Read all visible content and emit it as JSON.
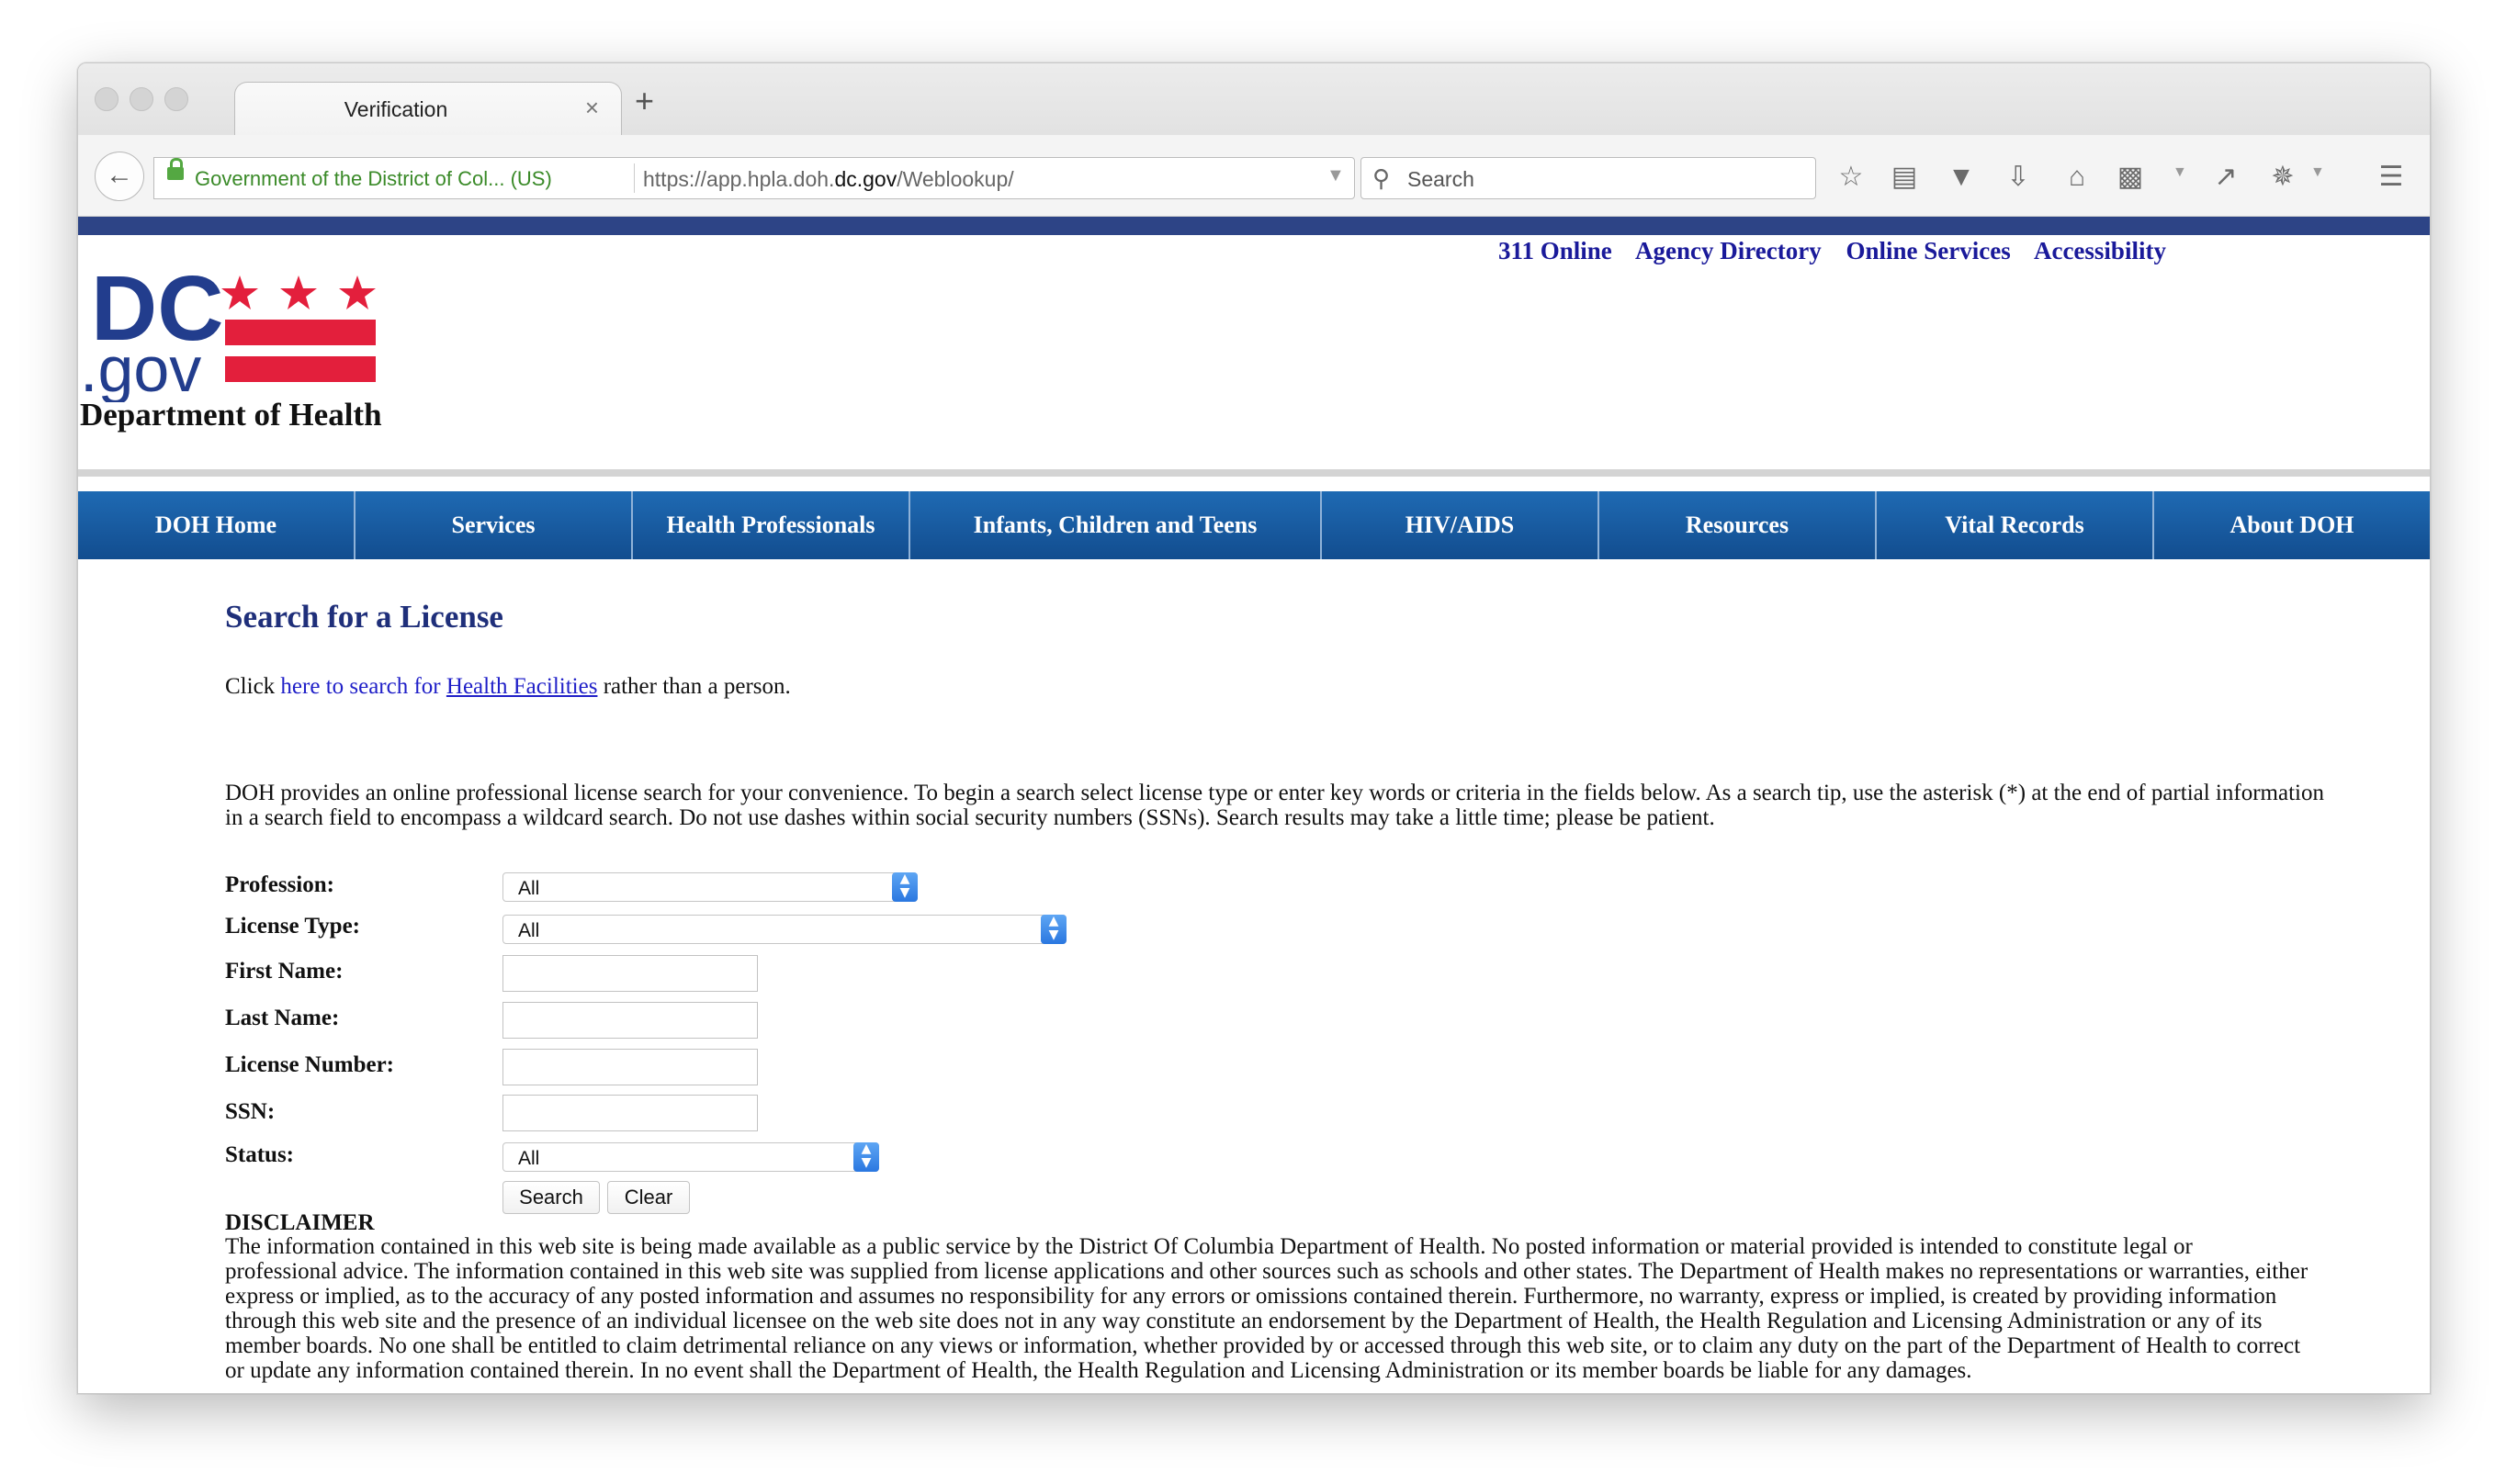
{
  "browser": {
    "tab_title": "Verification",
    "tab_close": "×",
    "new_tab": "+",
    "identity_org": "Government of the District of Col...  (US)",
    "url_prefix": "https://app.hpla.doh.",
    "url_domain": "dc.gov",
    "url_suffix": "/Weblookup/",
    "search_placeholder": "Search",
    "icons": [
      "back-icon",
      "lock-icon",
      "reload-icon",
      "search-icon",
      "bookmark-star-icon",
      "reading-list-icon",
      "pocket-icon",
      "download-icon",
      "home-icon",
      "pdf-icon",
      "tools-icon",
      "extension-icon",
      "menu-icon"
    ]
  },
  "site": {
    "util_links": [
      "311 Online",
      "Agency Directory",
      "Online Services",
      "Accessibility"
    ],
    "logo_text_dc": "DC",
    "logo_text_gov": ".gov",
    "department": "Department of Health",
    "colors": {
      "top_bar": "#2d4486",
      "nav": "#1a5da4",
      "flag_red": "#e31f3c",
      "logo_blue": "#223d8d",
      "title": "#1f2f7a",
      "link": "#2020c8"
    },
    "nav": [
      "DOH Home",
      "Services",
      "Health Professionals",
      "Infants, Children and Teens",
      "HIV/AIDS",
      "Resources",
      "Vital Records",
      "About DOH"
    ]
  },
  "search": {
    "title": "Search for a License",
    "click_prefix": "Click ",
    "click_link1": "here to search for ",
    "click_link2": "Health Facilities",
    "click_suffix": " rather than a person.",
    "intro": "DOH provides an online professional license search for your convenience. To begin a search select license type or enter key words or criteria in the fields below. As a search tip, use the asterisk (*) at the end of partial information in a search field to encompass a wildcard search. Do not use dashes within social security numbers (SSNs). Search results may take a little time; please be patient.",
    "fields": {
      "profession_label": "Profession:",
      "profession_value": "All",
      "license_type_label": "License Type:",
      "license_type_value": "All",
      "first_name_label": "First Name:",
      "first_name_value": "",
      "last_name_label": "Last Name:",
      "last_name_value": "",
      "license_number_label": "License Number:",
      "license_number_value": "",
      "ssn_label": "SSN:",
      "ssn_value": "",
      "status_label": "Status:",
      "status_value": "All"
    },
    "search_button": "Search",
    "clear_button": "Clear"
  },
  "disclaimer": {
    "title": "DISCLAIMER",
    "text": "The information contained in this web site is being made available as a public service by the District Of Columbia Department of Health. No posted information or material provided is intended to constitute legal or professional advice. The information contained in this web site was supplied from license applications and other sources such as schools and other states. The Department of Health makes no representations or warranties, either express or implied, as to the accuracy of any posted information and assumes no responsibility for any errors or omissions contained therein. Furthermore, no warranty, express or implied, is created by providing information through this web site and the presence of an individual licensee on the web site does not in any way constitute an endorsement by the Department of Health, the Health Regulation and Licensing Administration or any of its member boards. No one shall be entitled to claim detrimental reliance on any views or information, whether provided by or accessed through this web site, or to claim any duty on the part of the Department of Health to correct or update any information contained therein. In no event shall the Department of Health, the Health Regulation and Licensing Administration or its member boards be liable for any damages."
  }
}
